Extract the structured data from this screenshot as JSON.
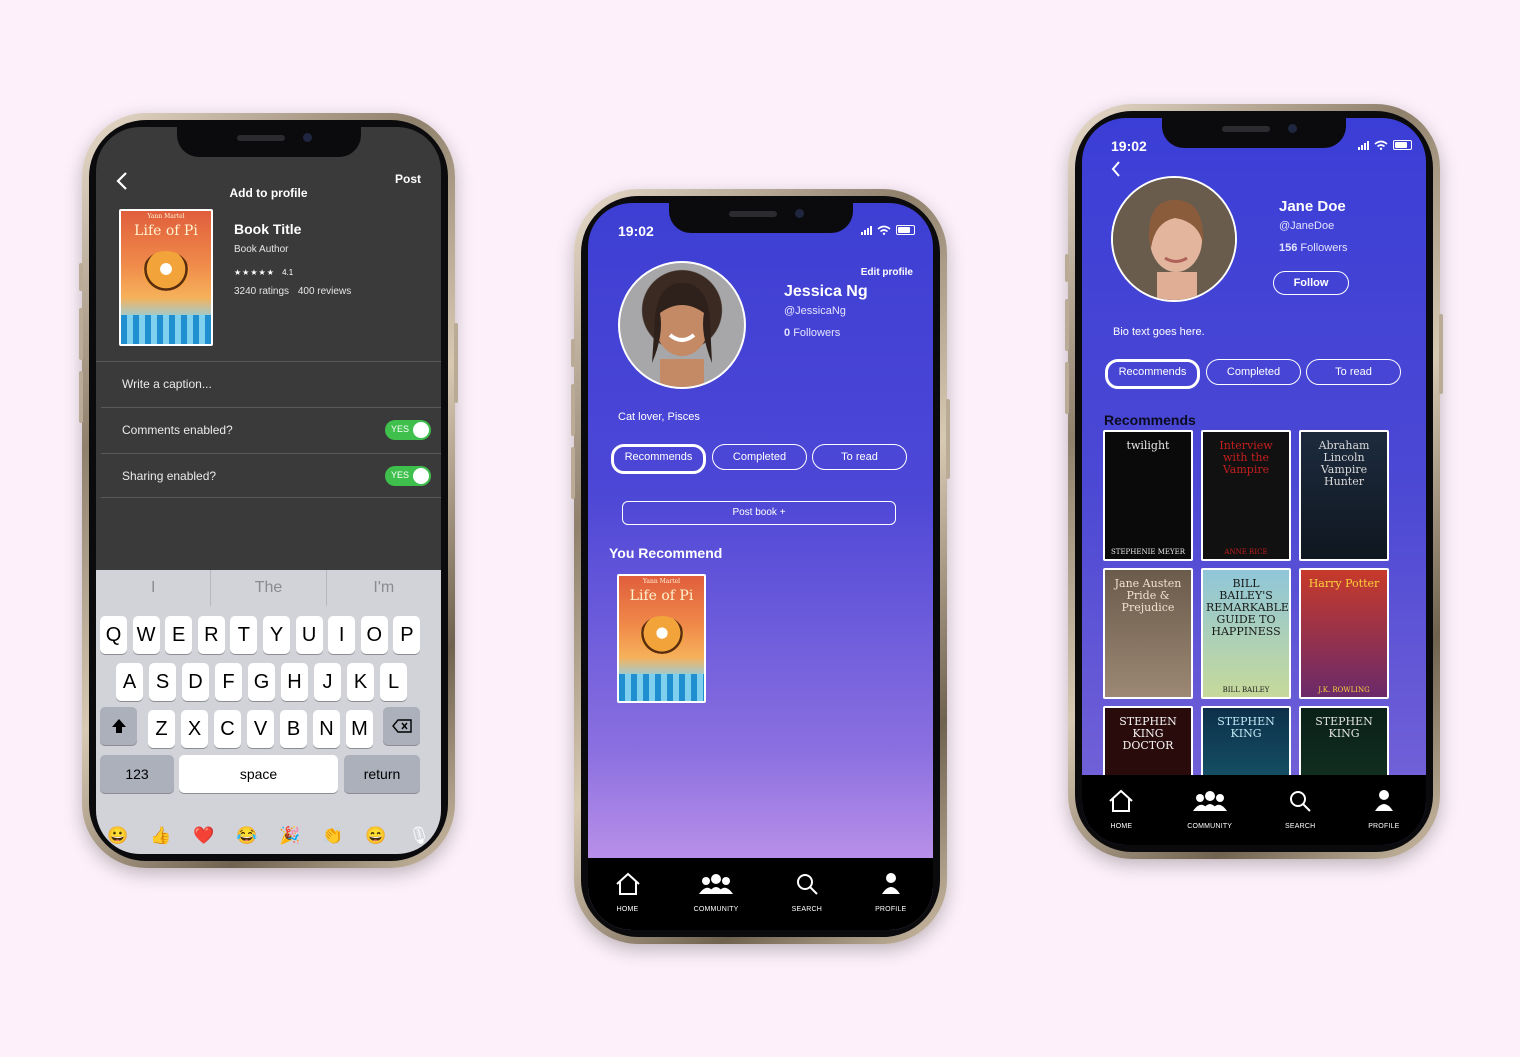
{
  "colors": {
    "background": "#fdf0fa",
    "accent": "#3d3fd4",
    "toggle_on": "#3fbf4c"
  },
  "add_to_profile": {
    "back_icon": "chevron-left-icon",
    "title": "Add to profile",
    "post_label": "Post",
    "book": {
      "cover_author": "Yann Martel",
      "cover_title": "Life of Pi",
      "title": "Book Title",
      "author": "Book Author",
      "stars": "★★★★★",
      "rating": "4.1",
      "ratings": "3240 ratings",
      "reviews": "400 reviews"
    },
    "caption_placeholder": "Write a caption...",
    "comments_label": "Comments enabled?",
    "comments_toggle": "YES",
    "sharing_label": "Sharing enabled?",
    "sharing_toggle": "YES",
    "keyboard": {
      "suggestions": [
        "I",
        "The",
        "I'm"
      ],
      "row1": [
        "Q",
        "W",
        "E",
        "R",
        "T",
        "Y",
        "U",
        "I",
        "O",
        "P"
      ],
      "row2": [
        "A",
        "S",
        "D",
        "F",
        "G",
        "H",
        "J",
        "K",
        "L"
      ],
      "row3": [
        "Z",
        "X",
        "C",
        "V",
        "B",
        "N",
        "M"
      ],
      "numbers": "123",
      "space": "space",
      "return": "return",
      "emoji": [
        "😀",
        "👍",
        "❤️",
        "😂",
        "🎉",
        "👏",
        "😄",
        "🎙"
      ]
    }
  },
  "my_profile": {
    "time": "19:02",
    "edit_label": "Edit profile",
    "name": "Jessica Ng",
    "handle": "@JessicaNg",
    "followers_count": "0",
    "followers_label": "Followers",
    "bio": "Cat lover, Pisces",
    "tabs": [
      "Recommends",
      "Completed",
      "To read"
    ],
    "post_book_label": "Post book  +",
    "section_title": "You Recommend",
    "book": {
      "cover_author": "Yann Martel",
      "cover_title": "Life of Pi"
    },
    "nav": [
      "HOME",
      "COMMUNITY",
      "SEARCH",
      "PROFILE"
    ]
  },
  "other_profile": {
    "time": "19:02",
    "name": "Jane Doe",
    "handle": "@JaneDoe",
    "followers_count": "156",
    "followers_label": "Followers",
    "follow_label": "Follow",
    "bio": "Bio text goes here.",
    "tabs": [
      "Recommends",
      "Completed",
      "To read"
    ],
    "section_title": "Recommends",
    "books": [
      {
        "title": "twilight",
        "author": "STEPHENIE MEYER"
      },
      {
        "title": "Interview with the Vampire",
        "author": "ANNE RICE"
      },
      {
        "title": "Abraham Lincoln Vampire Hunter",
        "author": ""
      },
      {
        "title": "Jane Austen Pride & Prejudice",
        "author": ""
      },
      {
        "title": "BILL BAILEY'S REMARKABLE GUIDE TO HAPPINESS",
        "author": "BILL BAILEY"
      },
      {
        "title": "Harry Potter",
        "author": "J.K. ROWLING"
      },
      {
        "title": "STEPHEN KING DOCTOR",
        "author": ""
      },
      {
        "title": "STEPHEN KING",
        "author": ""
      },
      {
        "title": "STEPHEN KING",
        "author": ""
      }
    ],
    "nav": [
      "HOME",
      "COMMUNITY",
      "SEARCH",
      "PROFILE"
    ]
  }
}
